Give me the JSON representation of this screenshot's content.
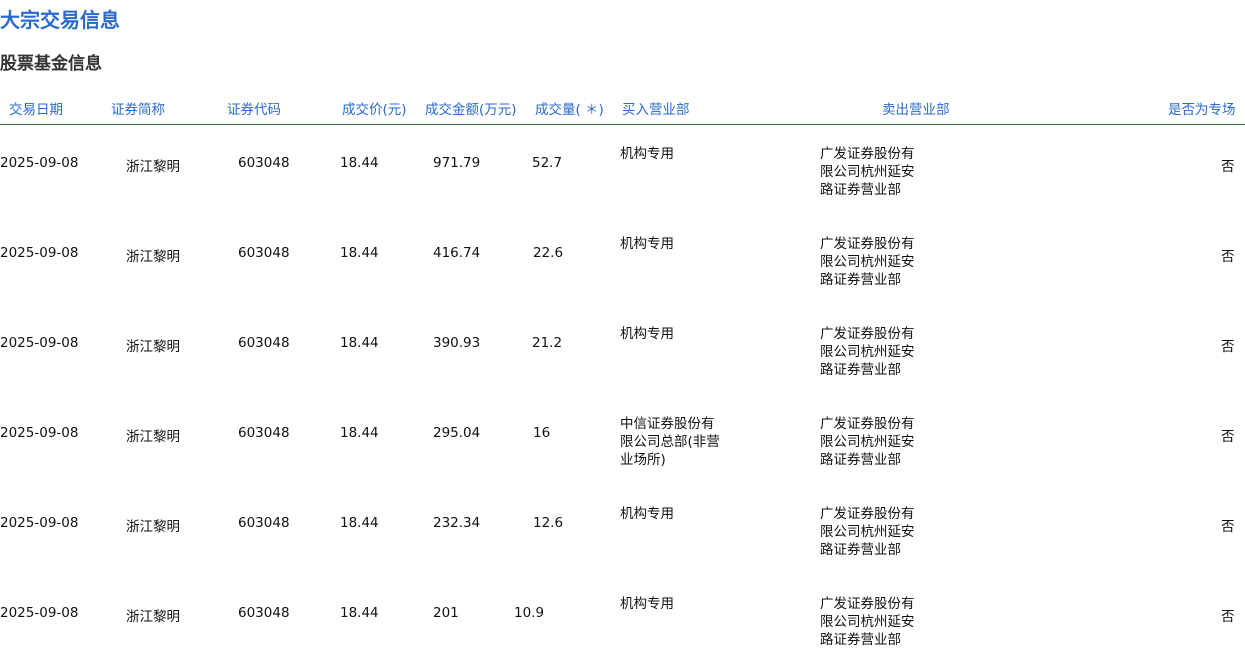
{
  "page": {
    "title": "大宗交易信息",
    "section_title": "股票基金信息"
  },
  "table": {
    "columns": [
      "交易日期",
      "证券简称",
      "证券代码",
      "成交价(元)",
      "成交金额(万元)",
      "成交量( ＊)",
      "买入营业部",
      "卖出营业部",
      "是否为专场"
    ],
    "rows": [
      {
        "date": "2025-09-08",
        "name": "浙江黎明",
        "code": "603048",
        "price": "18.44",
        "amount": "971.79",
        "volume": "52.7",
        "buyer": "机构专用",
        "seller": "广发证券股份有限公司杭州延安路证券营业部",
        "special": "否"
      },
      {
        "date": "2025-09-08",
        "name": "浙江黎明",
        "code": "603048",
        "price": "18.44",
        "amount": "416.74",
        "volume": "22.6",
        "buyer": "机构专用",
        "seller": "广发证券股份有限公司杭州延安路证券营业部",
        "special": "否"
      },
      {
        "date": "2025-09-08",
        "name": "浙江黎明",
        "code": "603048",
        "price": "18.44",
        "amount": "390.93",
        "volume": "21.2",
        "buyer": "机构专用",
        "seller": "广发证券股份有限公司杭州延安路证券营业部",
        "special": "否"
      },
      {
        "date": "2025-09-08",
        "name": "浙江黎明",
        "code": "603048",
        "price": "18.44",
        "amount": "295.04",
        "volume": "16",
        "buyer": "中信证券股份有限公司总部(非营业场所)",
        "seller": "广发证券股份有限公司杭州延安路证券营业部",
        "special": "否"
      },
      {
        "date": "2025-09-08",
        "name": "浙江黎明",
        "code": "603048",
        "price": "18.44",
        "amount": "232.34",
        "volume": "12.6",
        "buyer": "机构专用",
        "seller": "广发证券股份有限公司杭州延安路证券营业部",
        "special": "否"
      },
      {
        "date": "2025-09-08",
        "name": "浙江黎明",
        "code": "603048",
        "price": "18.44",
        "amount": "201",
        "volume": "10.9",
        "buyer": "机构专用",
        "seller": "广发证券股份有限公司杭州延安路证券营业部",
        "special": "否"
      }
    ]
  },
  "colors": {
    "accent": "#2a6acb",
    "divider": "#2e7d32"
  }
}
